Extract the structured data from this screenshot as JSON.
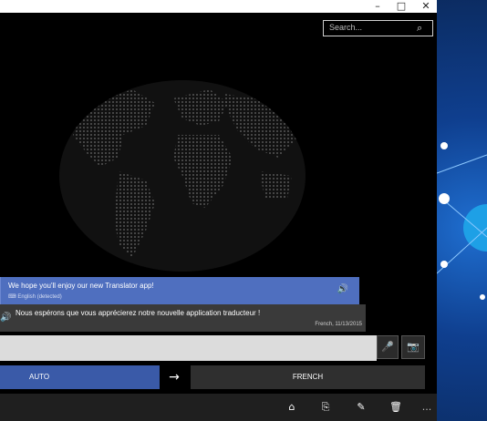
{
  "window": {
    "buttons": [
      {
        "name": "minimize-button",
        "glyph": "–"
      },
      {
        "name": "maximize-button",
        "glyph": "□"
      },
      {
        "name": "close-button",
        "glyph": "✕"
      }
    ]
  },
  "search": {
    "placeholder": "Search...",
    "icon": "search-icon"
  },
  "translations": [
    {
      "source_text": "We hope you'll enjoy our new Translator app!",
      "source_lang": "English (detected)",
      "icon": "speaker-icon"
    },
    {
      "target_text": "Nous espérons que vous apprécierez notre nouvelle application traducteur !",
      "meta": "French, 11/13/2015",
      "icon": "speaker-icon"
    }
  ],
  "input": {
    "value": "",
    "mic_icon": "microphone-icon",
    "camera_icon": "camera-icon"
  },
  "languages": {
    "from": "AUTO",
    "to": "FRENCH",
    "swap_icon": "arrow-right-icon"
  },
  "toolbar": {
    "icons": [
      "pin-icon",
      "copy-icon",
      "edit-icon",
      "delete-icon",
      "more-icon"
    ],
    "more_label": "..."
  },
  "colors": {
    "accent": "#3a5aa8",
    "source_card": "#4f6fbf",
    "target_card": "#3a3a3a",
    "desktop": "#0f3f8f"
  }
}
